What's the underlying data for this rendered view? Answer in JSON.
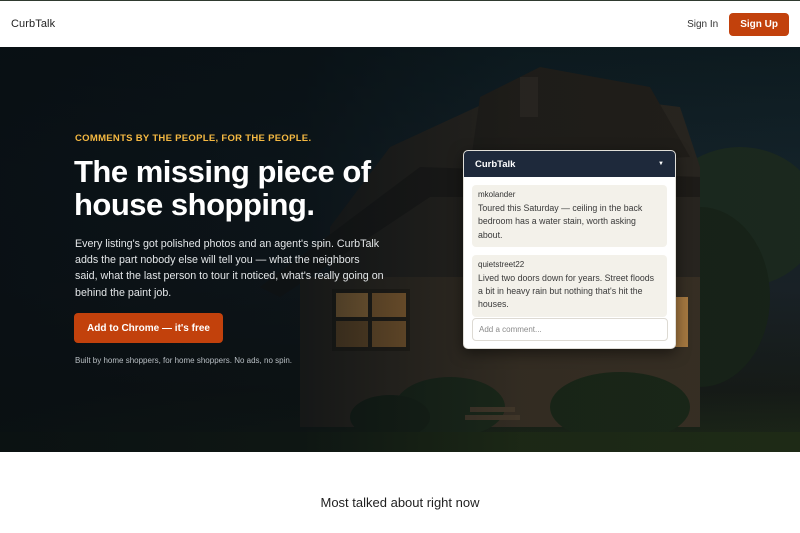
{
  "header": {
    "brand": "CurbTalk",
    "sign_in": "Sign In",
    "sign_up": "Sign Up"
  },
  "hero": {
    "eyebrow": "COMMENTS BY THE PEOPLE, FOR THE PEOPLE.",
    "headline": "The missing piece of house shopping.",
    "body": "Every listing's got polished photos and an agent's spin. CurbTalk adds the part nobody else will tell you — what the neighbors said, what the last person to tour it noticed, what's really going on behind the paint job.",
    "cta": "Add to Chrome — it's free",
    "fineprint": "Built by home shoppers, for home shoppers. No ads, no spin."
  },
  "widget": {
    "title": "CurbTalk",
    "toggle_icon": "caret-down-icon",
    "comments": [
      {
        "user": "mkolander",
        "text": "Toured this Saturday — ceiling in the back bedroom has a water stain, worth asking about."
      },
      {
        "user": "quietstreet22",
        "text": "Lived two doors down for years. Street floods a bit in heavy rain but nothing that's hit the houses."
      }
    ],
    "input_placeholder": "Add a comment..."
  },
  "section": {
    "title": "Most talked about right now"
  },
  "colors": {
    "accent": "#c2410c",
    "eyebrow": "#f5b942",
    "widget_header": "#1e293b"
  }
}
